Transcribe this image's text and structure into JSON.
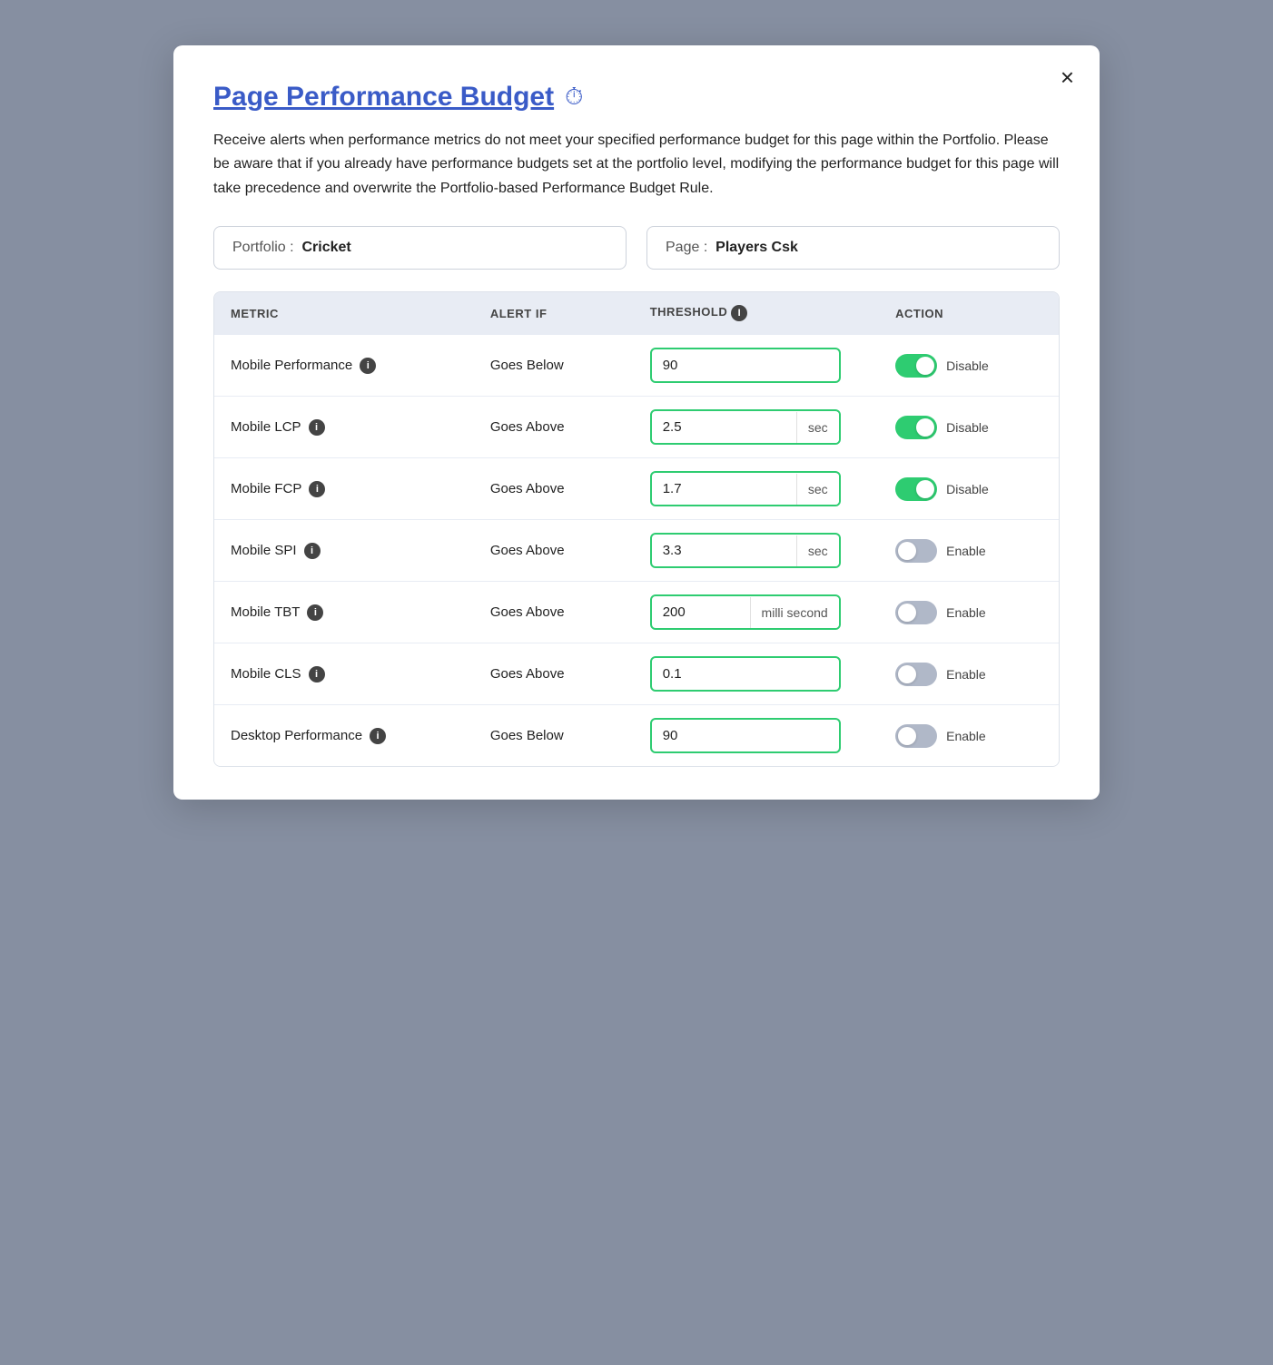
{
  "modal": {
    "title": "Page Performance Budget",
    "title_icon": "⏱",
    "close_label": "×",
    "description": "Receive alerts when performance metrics do not meet your specified performance budget for this page within the Portfolio. Please be aware that if you already have performance budgets set at the portfolio level, modifying the performance budget for this page will take precedence and overwrite the Portfolio-based Performance Budget Rule.",
    "portfolio_label": "Portfolio :",
    "portfolio_value": "Cricket",
    "page_label": "Page :",
    "page_value": "Players Csk",
    "table": {
      "headers": [
        "METRIC",
        "ALERT IF",
        "THRESHOLD",
        "ACTION"
      ],
      "rows": [
        {
          "metric": "Mobile Performance",
          "alert": "Goes Below",
          "value": "90",
          "unit": "",
          "enabled": true,
          "action_label": "Disable"
        },
        {
          "metric": "Mobile LCP",
          "alert": "Goes Above",
          "value": "2.5",
          "unit": "sec",
          "enabled": true,
          "action_label": "Disable"
        },
        {
          "metric": "Mobile FCP",
          "alert": "Goes Above",
          "value": "1.7",
          "unit": "sec",
          "enabled": true,
          "action_label": "Disable"
        },
        {
          "metric": "Mobile SPI",
          "alert": "Goes Above",
          "value": "3.3",
          "unit": "sec",
          "enabled": false,
          "action_label": "Enable"
        },
        {
          "metric": "Mobile TBT",
          "alert": "Goes Above",
          "value": "200",
          "unit": "milli second",
          "enabled": false,
          "action_label": "Enable"
        },
        {
          "metric": "Mobile CLS",
          "alert": "Goes Above",
          "value": "0.1",
          "unit": "",
          "enabled": false,
          "action_label": "Enable"
        },
        {
          "metric": "Desktop Performance",
          "alert": "Goes Below",
          "value": "90",
          "unit": "",
          "enabled": false,
          "action_label": "Enable"
        }
      ]
    }
  }
}
